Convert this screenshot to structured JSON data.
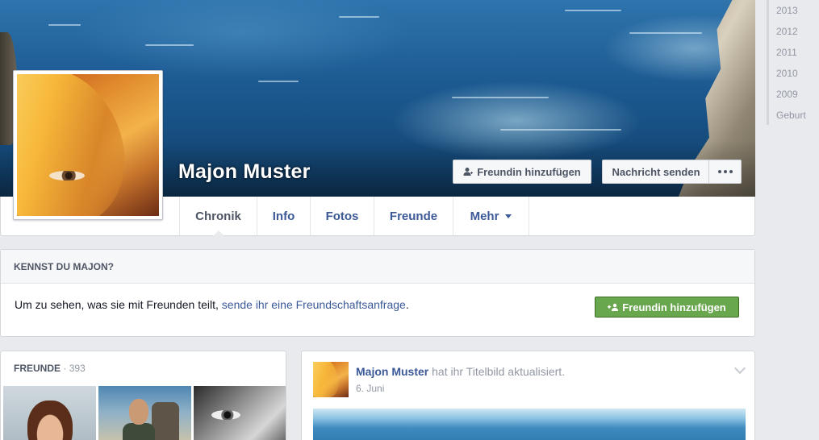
{
  "profile": {
    "name": "Majon Muster",
    "add_friend_label": "Freundin hinzufügen",
    "message_label": "Nachricht senden",
    "more_icon": "more-dots-icon"
  },
  "tabs": [
    {
      "label": "Chronik",
      "active": true
    },
    {
      "label": "Info",
      "active": false
    },
    {
      "label": "Fotos",
      "active": false
    },
    {
      "label": "Freunde",
      "active": false
    },
    {
      "label": "Mehr",
      "active": false
    }
  ],
  "know_box": {
    "title": "KENNST DU MAJON?",
    "text_before": "Um zu sehen, was sie mit Freunden teilt,",
    "link_text": "sende ihr eine Freundschaftsanfrage",
    "text_after": ".",
    "button_label": "Freundin hinzufügen"
  },
  "friends_box": {
    "title": "FREUNDE",
    "separator": "·",
    "count": "393"
  },
  "story": {
    "author": "Majon Muster",
    "action": "hat ihr Titelbild aktualisiert.",
    "date": "6. Juni"
  },
  "years": [
    "2013",
    "2012",
    "2011",
    "2010",
    "2009",
    "Geburt"
  ],
  "colors": {
    "link": "#3b5998",
    "green_button": "#69a74e",
    "page_bg": "#e9eaed"
  }
}
